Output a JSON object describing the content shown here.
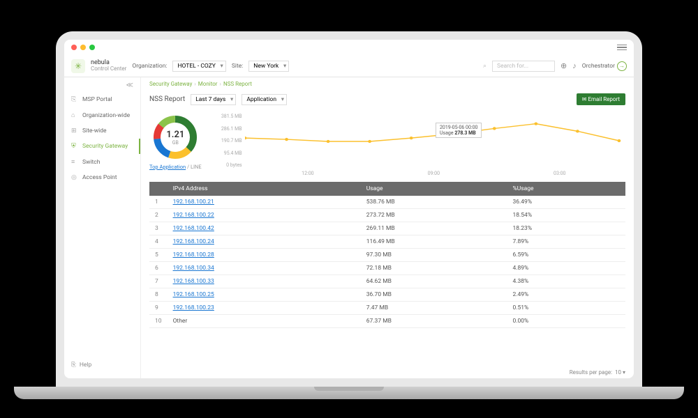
{
  "brand": {
    "name": "nebula",
    "sub": "Control Center"
  },
  "header": {
    "org_label": "Organization:",
    "org_value": "HOTEL - COZY",
    "site_label": "Site:",
    "site_value": "New York",
    "search_placeholder": "Search for...",
    "orchestrator": "Orchestrator"
  },
  "sidebar": {
    "items": [
      {
        "icon": "⎘",
        "label": "MSP Portal"
      },
      {
        "icon": "⌂",
        "label": "Organization-wide"
      },
      {
        "icon": "⊞",
        "label": "Site-wide"
      },
      {
        "icon": "⛨",
        "label": "Security Gateway"
      },
      {
        "icon": "≡",
        "label": "Switch"
      },
      {
        "icon": "◎",
        "label": "Access Point"
      }
    ],
    "help": "Help"
  },
  "breadcrumb": [
    "Security Gateway",
    "Monitor",
    "NSS Report"
  ],
  "toolbar": {
    "title": "NSS Report",
    "range": "Last 7 days",
    "group": "Application",
    "email": "✉ Email Report"
  },
  "donut": {
    "value": "1.21",
    "unit": "GB",
    "link_text": "Top Application",
    "link_suffix": " / LINE"
  },
  "chart_data": {
    "type": "line",
    "title": "",
    "xlabel": "",
    "ylabel": "",
    "ylim": [
      0,
      381.5
    ],
    "y_ticks": [
      "381.5 MB",
      "286.1 MB",
      "190.7 MB",
      "95.4 MB",
      "0 bytes"
    ],
    "x_ticks": [
      "12:00",
      "09:00",
      "03:00"
    ],
    "series": [
      {
        "name": "Usage",
        "values": [
          210,
          200,
          185,
          185,
          210,
          240,
          278.3,
          310,
          260,
          190
        ]
      }
    ],
    "tooltip": {
      "time": "2019-05-06 00:00",
      "label": "Usage",
      "value": "278.3 MB"
    }
  },
  "table": {
    "headers": [
      "",
      "IPv4 Address",
      "Usage",
      "%Usage"
    ],
    "rows": [
      {
        "n": "1",
        "ip": "192.168.100.21",
        "usage": "538.76 MB",
        "pct": "36.49%"
      },
      {
        "n": "2",
        "ip": "192.168.100.22",
        "usage": "273.72 MB",
        "pct": "18.54%"
      },
      {
        "n": "3",
        "ip": "192.168.100.42",
        "usage": "269.11 MB",
        "pct": "18.23%"
      },
      {
        "n": "4",
        "ip": "192.168.100.24",
        "usage": "116.49 MB",
        "pct": "7.89%"
      },
      {
        "n": "5",
        "ip": "192.168.100.28",
        "usage": "97.30 MB",
        "pct": "6.59%"
      },
      {
        "n": "6",
        "ip": "192.168.100.34",
        "usage": "72.18 MB",
        "pct": "4.89%"
      },
      {
        "n": "7",
        "ip": "192.168.100.33",
        "usage": "64.62 MB",
        "pct": "4.38%"
      },
      {
        "n": "8",
        "ip": "192.168.100.25",
        "usage": "36.70 MB",
        "pct": "2.49%"
      },
      {
        "n": "9",
        "ip": "192.168.100.23",
        "usage": "7.47 MB",
        "pct": "0.51%"
      },
      {
        "n": "10",
        "ip": "Other",
        "usage": "67.37 MB",
        "pct": "0.00%",
        "plain": true
      }
    ]
  },
  "pager": {
    "label": "Results per page:",
    "value": "10"
  }
}
